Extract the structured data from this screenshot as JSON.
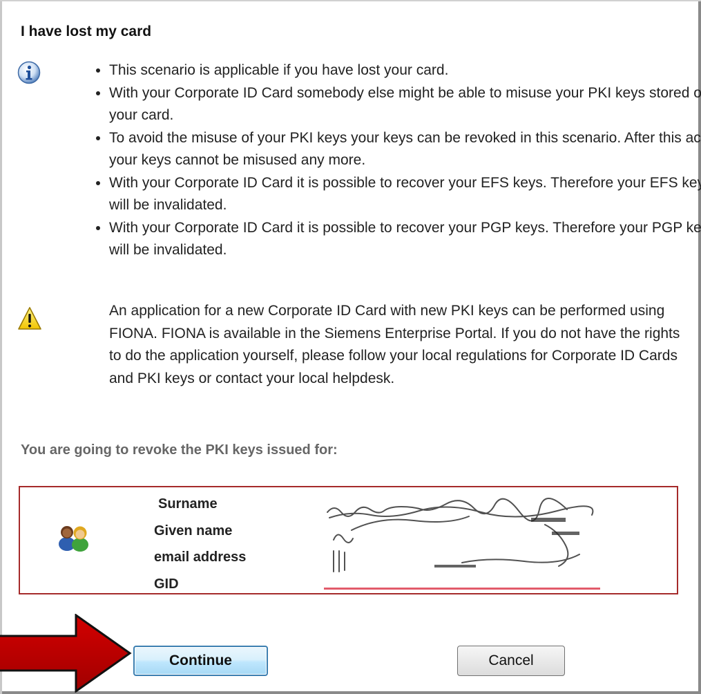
{
  "dialog": {
    "title": "I have lost my card",
    "info_icon": "info-icon",
    "bullets": [
      "This scenario is applicable if you have lost your card.",
      "With your Corporate ID Card somebody else might be able to misuse your PKI keys stored on your card.",
      "To avoid the misuse of your PKI keys your keys can be revoked in this scenario. After this action your keys cannot be misused any more.",
      "With your Corporate ID Card it is possible to recover your EFS keys. Therefore your EFS keys will be invalidated.",
      "With your Corporate ID Card it is possible to recover your PGP keys. Therefore your PGP keys will be invalidated."
    ],
    "warning_icon": "warning-icon",
    "warning_text": "An application for a new Corporate ID Card with new PKI keys can be performed using FIONA. FIONA is available in the Siemens Enterprise Portal. If you do not have the rights to do the application yourself, please follow your local regulations for Corporate ID Cards and PKI keys or contact your local helpdesk.",
    "revoke_heading": "You are going to revoke the PKI keys issued for:",
    "user_icon": "users-icon",
    "fields": [
      "Surname",
      "Given name",
      "email address",
      "GID"
    ],
    "buttons": {
      "continue_label": "Continue",
      "cancel_label": "Cancel"
    },
    "annotation_arrow_color": "#c00000",
    "box_border_color": "#a52a2a"
  }
}
